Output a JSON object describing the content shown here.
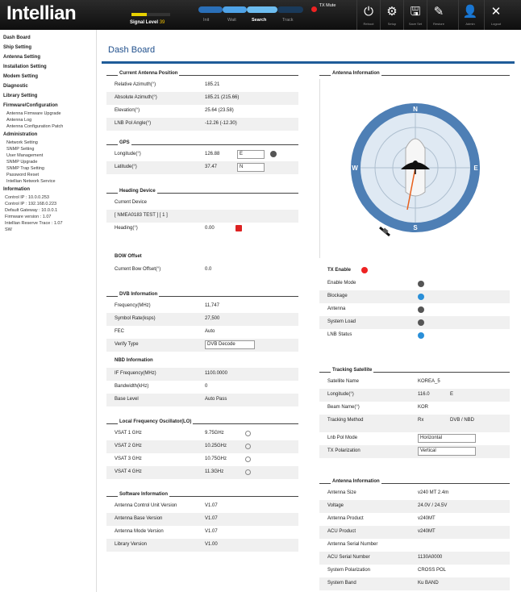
{
  "header": {
    "logo": "Intellian",
    "signal": {
      "label": "Signal Level",
      "value": "39",
      "level_fraction": 0.39
    },
    "modes": [
      "Init",
      "Wait",
      "Search",
      "Track"
    ],
    "tx_mute": "TX Mute",
    "toolbar": [
      "Reboot",
      "Setup",
      "Save Set",
      "Restore",
      "Admin",
      "Logout"
    ]
  },
  "sidebar": {
    "headings": [
      "Dash Board",
      "Ship Setting",
      "Antenna Setting",
      "Installation Setting",
      "Modem Setting",
      "Diagnostic",
      "Library Setting",
      "Firmware/Configuration",
      "Administration",
      "Information"
    ],
    "firmware_items": [
      "Antenna Firmware Upgrade",
      "Antenna Log",
      "Antenna Configuration Patch"
    ],
    "admin_items": [
      "Network Setting",
      "SNMP Setting",
      "User Management",
      "SNMP Upgrade",
      "SNMP Trap Setting",
      "Password Reset",
      "Intellian Network Service"
    ],
    "info_lines": [
      "Control IP : 10.0.0.253",
      "Control IP : 192.168.0.223",
      "Default Gateway : 10.0.0.1",
      "Firmware version : 1.07",
      "Intellian Reserve Trace : 1.07",
      "SW"
    ]
  },
  "page_title": "Dash Board",
  "antenna_position": {
    "title": "Current Antenna Position",
    "rows": [
      {
        "k": "Relative Azimuth(°)",
        "v": "185.21"
      },
      {
        "k": "Absolute Azimuth(°)",
        "v": "185.21 (215.66)"
      },
      {
        "k": "Elevation(°)",
        "v": "25.64 (23.58)"
      },
      {
        "k": "LNB Pol Angle(°)",
        "v": "-12.26 (-12.30)"
      }
    ]
  },
  "gps": {
    "title": "GPS",
    "rows": [
      {
        "k": "Longitude(°)",
        "v": "126.88",
        "v2": "E",
        "gear": true
      },
      {
        "k": "Latitude(°)",
        "v": "37.47",
        "v2": "N"
      }
    ]
  },
  "heading_device": {
    "title": "Heading Device",
    "rows": [
      {
        "k": "Current Device",
        "v": ""
      },
      {
        "k": "[ NMEA0183 TEST ] [ 1 ]",
        "v": ""
      },
      {
        "k": "Heading(°)",
        "v": "0.00"
      }
    ]
  },
  "boresight": {
    "title": "BOW Offset",
    "rows": [
      {
        "k": "Current Bow Offset(°)",
        "v": "0.0"
      }
    ]
  },
  "dvb": {
    "title": "DVB Information",
    "rows": [
      {
        "k": "Frequency(MHz)",
        "v": "11,747"
      },
      {
        "k": "Symbol Rate(ksps)",
        "v": "27,500"
      },
      {
        "k": "FEC",
        "v": "Auto"
      },
      {
        "k": "Verify Type",
        "v": "DVB Decode"
      }
    ]
  },
  "nbd": {
    "title": "NBD Information",
    "rows": [
      {
        "k": "IF Frequency(MHz)",
        "v": "1100.0000"
      },
      {
        "k": "Bandwidth(kHz)",
        "v": "0"
      },
      {
        "k": "Base Level",
        "v": "Auto Pass"
      }
    ]
  },
  "lnb": {
    "title": "Local Frequency Oscillator(LO)",
    "rows": [
      {
        "k": "VSAT 1 GHz",
        "v": "9.75GHz"
      },
      {
        "k": "VSAT 2 GHz",
        "v": "10.25GHz"
      },
      {
        "k": "VSAT 3 GHz",
        "v": "10.75GHz"
      },
      {
        "k": "VSAT 4 GHz",
        "v": "11.3GHz"
      }
    ]
  },
  "software": {
    "title": "Software Information",
    "rows": [
      {
        "k": "Antenna Control Unit Version",
        "v": "V1.07"
      },
      {
        "k": "Antenna Base Version",
        "v": "V1.07"
      },
      {
        "k": "Antenna Mode Version",
        "v": "V1.07"
      },
      {
        "k": "Library Version",
        "v": "V1.00"
      }
    ]
  },
  "antenna_info": {
    "title": "Antenna Information"
  },
  "tx_enable": {
    "title": "TX Enable",
    "rows": [
      {
        "k": "Enable Mode",
        "color": "#555555"
      },
      {
        "k": "Blockage",
        "color": "#2a8fd8"
      },
      {
        "k": "Antenna",
        "color": "#555555"
      },
      {
        "k": "System Load",
        "color": "#555555"
      },
      {
        "k": "LNB Status",
        "color": "#2a8fd8"
      }
    ]
  },
  "tracking": {
    "title": "Tracking Satellite",
    "rows": [
      {
        "k": "Satellite Name",
        "v": "KOREA_5"
      },
      {
        "k": "Longitude(°)",
        "v": "116.0",
        "v2": "E"
      },
      {
        "k": "Beam Name(°)",
        "v": "KOR"
      },
      {
        "k": "Tracking Method",
        "v": "Rx",
        "v2": "DVB / NBD"
      },
      {
        "k": "Lnb Pol Mode",
        "v": "Horizontal"
      },
      {
        "k": "TX Polarization",
        "v": "Vertical"
      }
    ]
  },
  "antenna_information": {
    "title": "Antenna Information",
    "rows": [
      {
        "k": "Antenna Size",
        "v": "v240 MT 2.4m"
      },
      {
        "k": "Voltage",
        "v": "24.0V / 24.5V"
      },
      {
        "k": "Antenna Product",
        "v": "v240MT"
      },
      {
        "k": "ACU Product",
        "v": "v240MT"
      },
      {
        "k": "Antenna Serial Number",
        "v": ""
      },
      {
        "k": "ACU Serial Number",
        "v": "1130A0000"
      },
      {
        "k": "System Polarization",
        "v": "CROSS POL"
      },
      {
        "k": "System Band",
        "v": "Ku BAND"
      }
    ]
  },
  "compass": {
    "labels": [
      "N",
      "E",
      "S",
      "W"
    ],
    "azimuth_deg": 185
  }
}
